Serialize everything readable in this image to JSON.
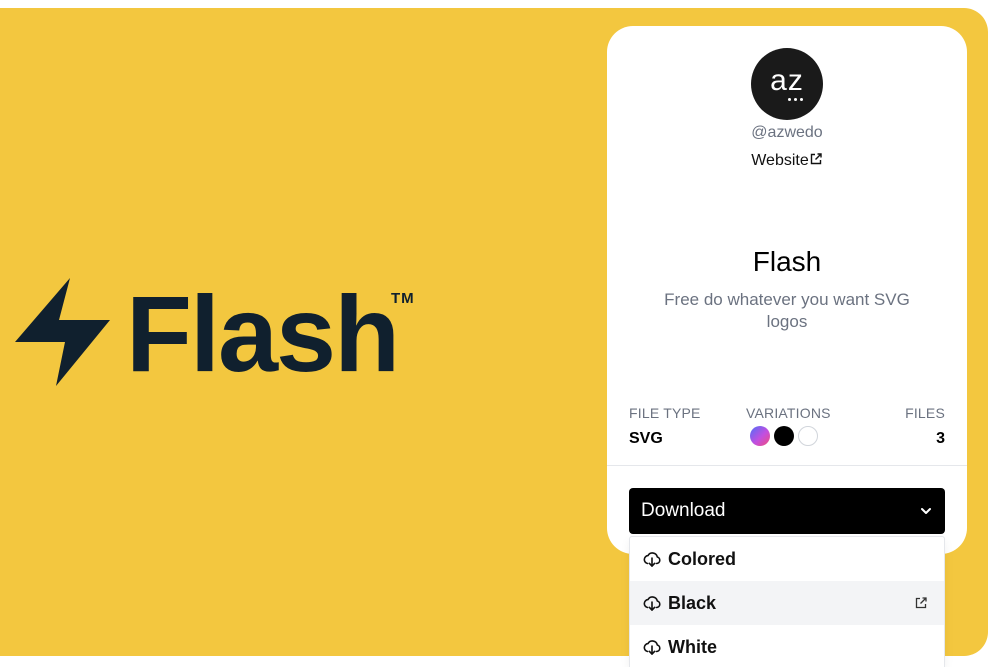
{
  "hero": {
    "wordmark": "Flash",
    "trademark": "TM",
    "background_color": "#f3c73f",
    "ink_color": "#10202e"
  },
  "author": {
    "avatar_text": "az",
    "handle": "@azwedo",
    "website_label": "Website",
    "website_icon": "external-link-icon"
  },
  "logo": {
    "title": "Flash",
    "description": "Free do whatever you want SVG logos"
  },
  "meta": {
    "file_type_label": "FILE TYPE",
    "file_type_value": "SVG",
    "variations_label": "VARIATIONS",
    "variations": [
      "colored",
      "black",
      "white"
    ],
    "files_label": "FILES",
    "files_value": "3"
  },
  "download": {
    "label": "Download",
    "icon": "chevron-down-icon",
    "options": [
      {
        "label": "Colored",
        "icon": "download-cloud-icon",
        "active": false
      },
      {
        "label": "Black",
        "icon": "download-cloud-icon",
        "active": true
      },
      {
        "label": "White",
        "icon": "download-cloud-icon",
        "active": false
      }
    ]
  }
}
